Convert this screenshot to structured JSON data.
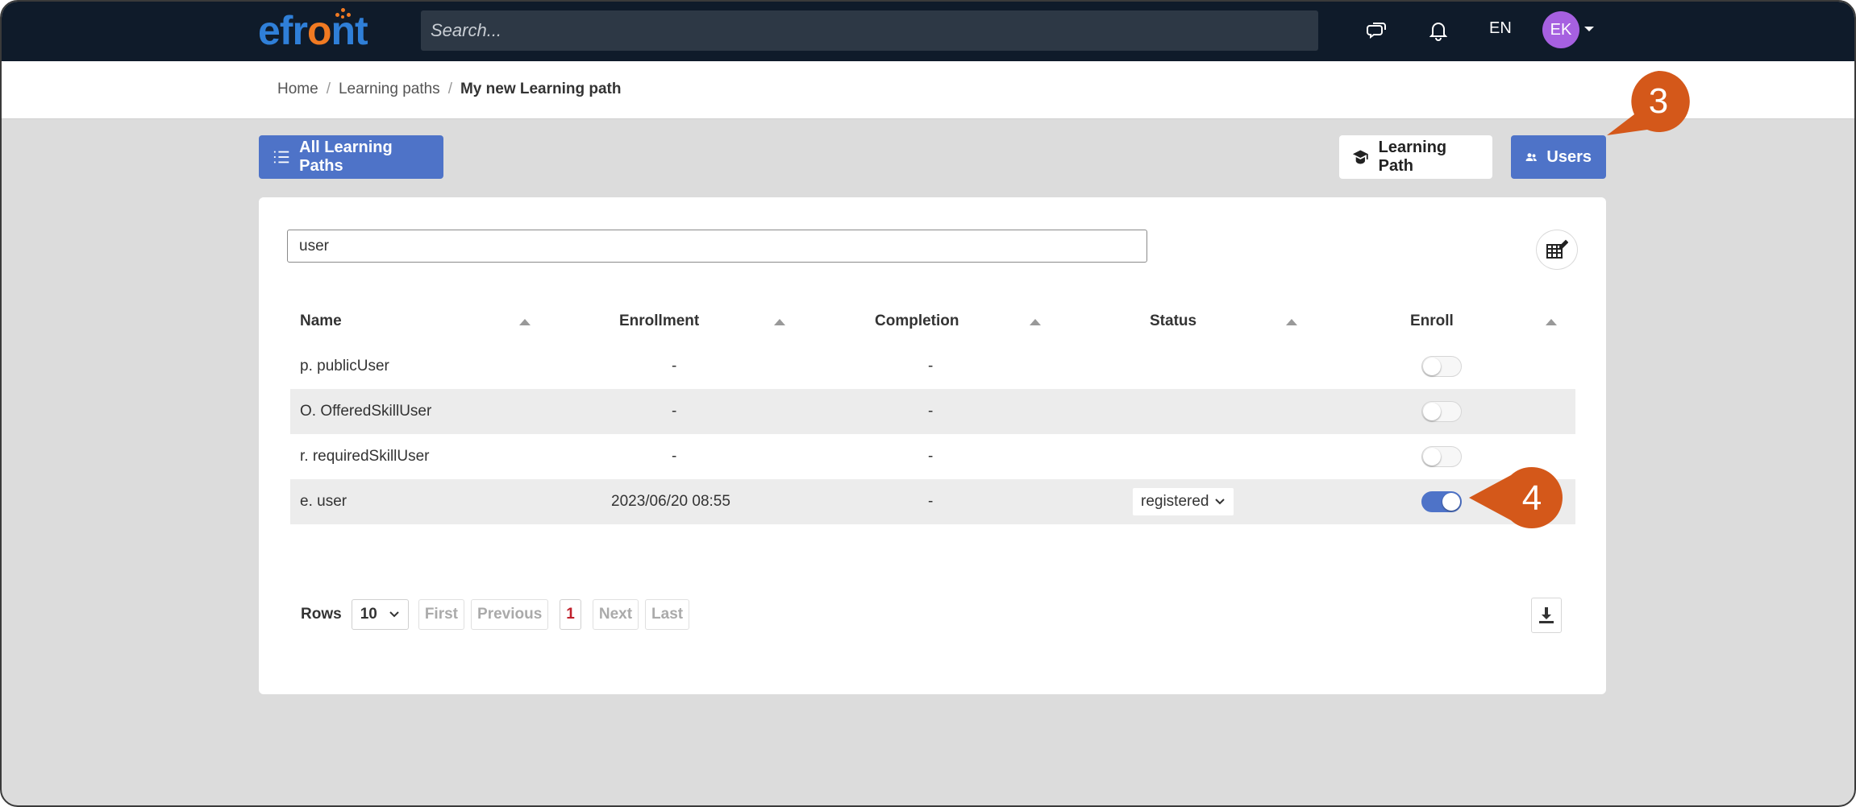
{
  "app": {
    "logo_text_a": "ef",
    "logo_text_b": "r",
    "logo_text_c": "o",
    "logo_text_d": "nt"
  },
  "topbar": {
    "search_placeholder": "Search...",
    "language": "EN",
    "avatar_initials": "EK",
    "icons": [
      "chat-icon",
      "bell-icon"
    ]
  },
  "breadcrumb": {
    "home": "Home",
    "sep": "/",
    "learning_paths": "Learning paths",
    "current": "My new Learning path"
  },
  "actions": {
    "all_paths": "All Learning Paths",
    "learning_path": "Learning Path",
    "users": "Users"
  },
  "filter": {
    "value": "user"
  },
  "table": {
    "headers": {
      "name": "Name",
      "enrollment": "Enrollment",
      "completion": "Completion",
      "status": "Status",
      "enroll": "Enroll"
    },
    "rows": [
      {
        "name": "p. publicUser",
        "enrollment": "-",
        "completion": "-",
        "status": "",
        "enrolled": false
      },
      {
        "name": "O. OfferedSkillUser",
        "enrollment": "-",
        "completion": "-",
        "status": "",
        "enrolled": false
      },
      {
        "name": "r. requiredSkillUser",
        "enrollment": "-",
        "completion": "-",
        "status": "",
        "enrolled": false
      },
      {
        "name": "e. user",
        "enrollment": "2023/06/20 08:55",
        "completion": "-",
        "status": "registered",
        "enrolled": true
      }
    ]
  },
  "pagination": {
    "rows_label": "Rows",
    "rows_value": "10",
    "first": "First",
    "previous": "Previous",
    "page": "1",
    "next": "Next",
    "last": "Last"
  },
  "callouts": {
    "step3": "3",
    "step4": "4",
    "color": "#d4581a"
  },
  "colors": {
    "primary": "#4e73c8",
    "nav": "#0f1b2a",
    "accent_orange": "#f07a22",
    "avatar": "#a660e0"
  }
}
